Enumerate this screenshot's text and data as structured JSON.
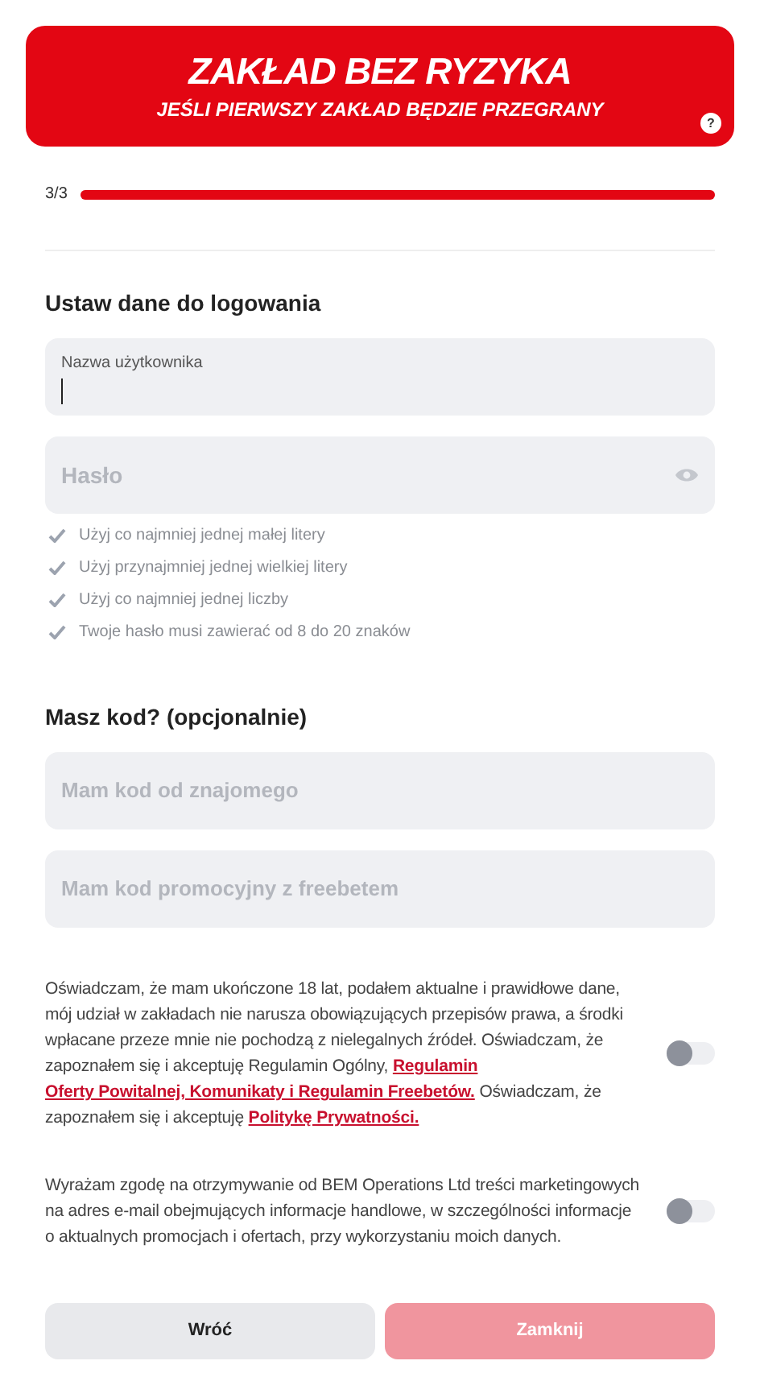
{
  "banner": {
    "title": "ZAKŁAD BEZ RYZYKA",
    "subtitle": "JEŚLI PIERWSZY ZAKŁAD BĘDZIE PRZEGRANY",
    "help": "?"
  },
  "progress": {
    "label": "3/3",
    "level": 1
  },
  "login": {
    "heading": "Ustaw dane do logowania",
    "fields": [
      {
        "kind": "text",
        "placeholder": "Nazwa użytkownika",
        "focused": true
      },
      {
        "kind": "password",
        "placeholder": "Hasło",
        "focused": false
      }
    ],
    "rules": [
      {
        "text": "Użyj co najmniej jednej małej litery",
        "met": false
      },
      {
        "text": "Użyj przynajmniej jednej wielkiej litery",
        "met": false
      },
      {
        "text": "Użyj co najmniej jednej liczby",
        "met": false
      },
      {
        "text": "Twoje hasło musi zawierać od 8 do 20 znaków",
        "met": false
      }
    ]
  },
  "code": {
    "heading": "Masz kod? (opcjonalnie)",
    "fields": [
      {
        "placeholder": "Mam kod od znajomego"
      },
      {
        "placeholder": "Mam kod promocyjny z freebetem"
      }
    ]
  },
  "consents": [
    {
      "on": false,
      "parts": [
        {
          "kind": "text",
          "text": "Oświadczam, że mam ukończone 18 lat, podałem aktualne i prawidłowe dane, mój udział w zakładach nie narusza obowiązujących przepisów prawa, a środki wpłacane przeze mnie nie pochodzą z nielegalnych źródeł. Oświadczam, że zapoznałem się i akceptuję Regulamin Ogólny, "
        },
        {
          "kind": "link",
          "text": "Regulamin"
        },
        {
          "kind": "link",
          "text": "Oferty Powitalnej, Komunikaty i Regulamin Freebetów."
        },
        {
          "kind": "text",
          "text": " Oświadczam, że zapoznałem się i akceptuję "
        },
        {
          "kind": "link",
          "text": "Politykę Prywatności."
        }
      ]
    },
    {
      "on": false,
      "parts": [
        {
          "kind": "text",
          "text": "Wyrażam zgodę na otrzymywanie od BEM Operations Ltd treści marketingowych na adres e-mail obejmujących informacje handlowe, w szczególności informacje o aktualnych promocjach i ofertach, przy wykorzystaniu moich danych."
        }
      ]
    }
  ],
  "buttons": {
    "back": "Wróć",
    "submit": "Zamknij",
    "submit_disabled": true
  }
}
